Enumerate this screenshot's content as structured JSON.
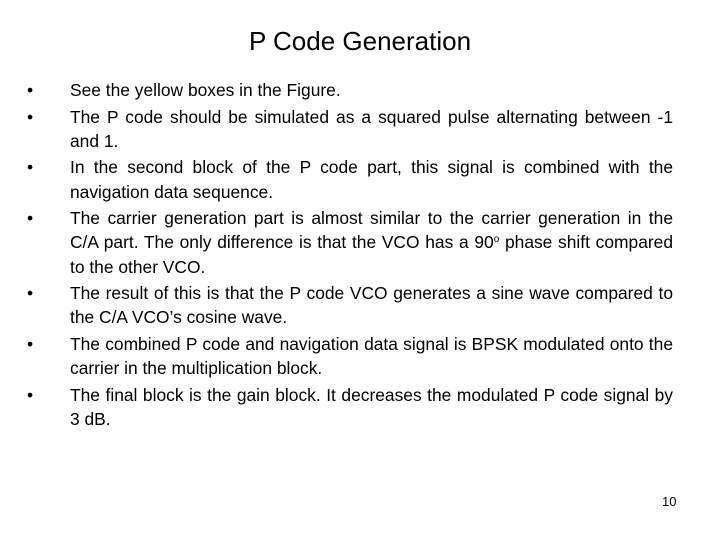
{
  "slide": {
    "title": "P Code Generation",
    "bullets": [
      {
        "text": "See the yellow boxes in the Figure."
      },
      {
        "text": "The P code should be simulated as a squared pulse alternating between -1 and 1."
      },
      {
        "text": "In the second block of the P code part, this signal is combined with the navigation data sequence."
      },
      {
        "text_before": "The carrier generation part is almost similar to the carrier generation in the C/A part. The only difference is that the VCO has a 90",
        "superscript": "o",
        "text_after": " phase shift compared to the other VCO."
      },
      {
        "text": "The result of this is that the P code VCO generates a sine wave compared to the C/A VCO’s cosine wave."
      },
      {
        "text": "The combined P code and navigation data signal is BPSK modulated onto the carrier in the multiplication block."
      },
      {
        "text": "The final block is the gain block. It decreases the modulated P code signal by 3 dB."
      }
    ],
    "bullet_glyph": "•",
    "page_number": "10"
  }
}
